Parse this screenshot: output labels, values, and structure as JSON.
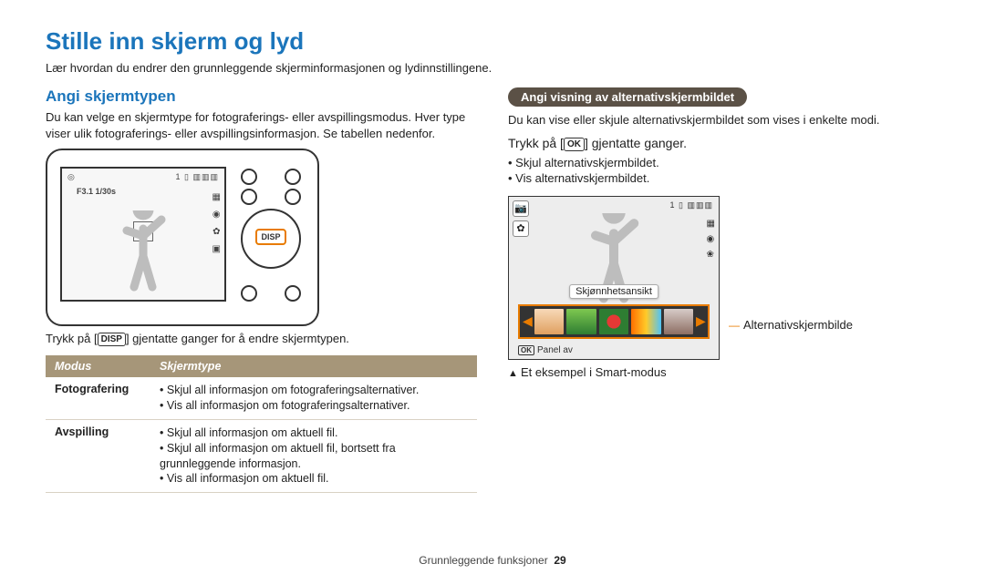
{
  "title": "Stille inn skjerm og lyd",
  "intro": "Lær hvordan du endrer den grunnleggende skjerminformasjonen og lydinnstillingene.",
  "left": {
    "heading": "Angi skjermtypen",
    "desc": "Du kan velge en skjermtype for fotograferings- eller avspillingsmodus. Hver type viser ulik fotograferings- eller avspillingsinformasjon. Se tabellen nedenfor.",
    "lcd": {
      "exposure": "F3.1 1/30s",
      "top_right": "1 ▯ ▥▥▥",
      "disp_label": "DISP"
    },
    "caption_pre": "Trykk på [",
    "caption_chip": "DISP",
    "caption_post": "] gjentatte ganger for å endre skjermtypen.",
    "table": {
      "head_mode": "Modus",
      "head_type": "Skjermtype",
      "rows": [
        {
          "mode": "Fotografering",
          "items": [
            "Skjul all informasjon om fotograferingsalternativer.",
            "Vis all informasjon om fotograferingsalternativer."
          ]
        },
        {
          "mode": "Avspilling",
          "items": [
            "Skjul all informasjon om aktuell fil.",
            "Skjul all informasjon om aktuell fil, bortsett fra grunnleggende informasjon.",
            "Vis all informasjon om aktuell fil."
          ]
        }
      ]
    }
  },
  "right": {
    "pill": "Angi visning av alternativskjermbildet",
    "desc": "Du kan vise eller skjule alternativskjermbildet som vises i enkelte modi.",
    "instruct_pre": "Trykk på [",
    "instruct_chip": "OK",
    "instruct_post": "] gjentatte ganger.",
    "bullets": [
      "Skjul alternativskjermbildet.",
      "Vis alternativskjermbildet."
    ],
    "alt_screen": {
      "top_right": "1 ▯ ▥▥▥",
      "tooltip": "Skjønnhetsansikt",
      "panel_off_chip": "OK",
      "panel_off": "Panel av"
    },
    "side_label": "Alternativskjermbilde",
    "example_note": "Et eksempel i Smart-modus"
  },
  "footer": {
    "section": "Grunnleggende funksjoner",
    "page": "29"
  }
}
